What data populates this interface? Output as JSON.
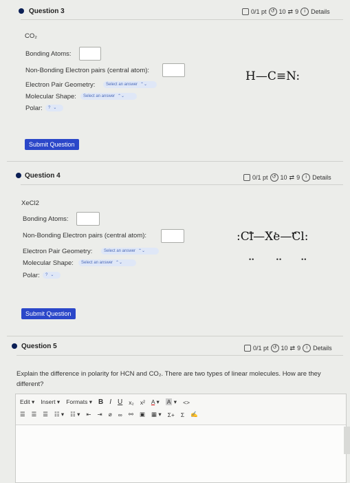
{
  "q3": {
    "title": "Question 3",
    "score": "0/1 pt",
    "retries": "10",
    "attempts": "9",
    "details": "Details",
    "molecule": "CO₂",
    "bonding_label": "Bonding Atoms:",
    "nonbonding_label": "Non-Bonding Electron pairs (central atom):",
    "epg_label": "Electron Pair Geometry:",
    "epg_value": "Select an answer",
    "shape_label": "Molecular Shape:",
    "shape_value": "Select an answer",
    "polar_label": "Polar:",
    "polar_value": "?",
    "submit": "Submit Question",
    "lewis": "H—C≡N:"
  },
  "q4": {
    "title": "Question 4",
    "score": "0/1 pt",
    "retries": "10",
    "attempts": "9",
    "details": "Details",
    "molecule": "XeCl2",
    "bonding_label": "Bonding Atoms:",
    "nonbonding_label": "Non-Bonding Electron pairs (central atom):",
    "epg_label": "Electron Pair Geometry:",
    "epg_value": "Select an answer",
    "shape_label": "Molecular Shape:",
    "shape_value": "Select an answer",
    "polar_label": "Polar:",
    "polar_value": "?",
    "submit": "Submit Question",
    "lewis": ":Cl—Xe—Cl:"
  },
  "q5": {
    "title": "Question 5",
    "score": "0/1 pt",
    "retries": "10",
    "attempts": "9",
    "details": "Details",
    "prompt": "Explain the difference in polarity for HCN and CO₂. There are two types of linear molecules. How are they different?"
  },
  "editor": {
    "menu_edit": "Edit",
    "menu_insert": "Insert",
    "menu_formats": "Formats",
    "bold": "B",
    "italic": "I",
    "underline": "U",
    "sub": "x₂",
    "sup": "x²",
    "font_color": "A",
    "bg_color": "A",
    "code": "<>",
    "sigma": "Σ",
    "sigma2": "Σ",
    "sum_plus": "Σ+"
  }
}
